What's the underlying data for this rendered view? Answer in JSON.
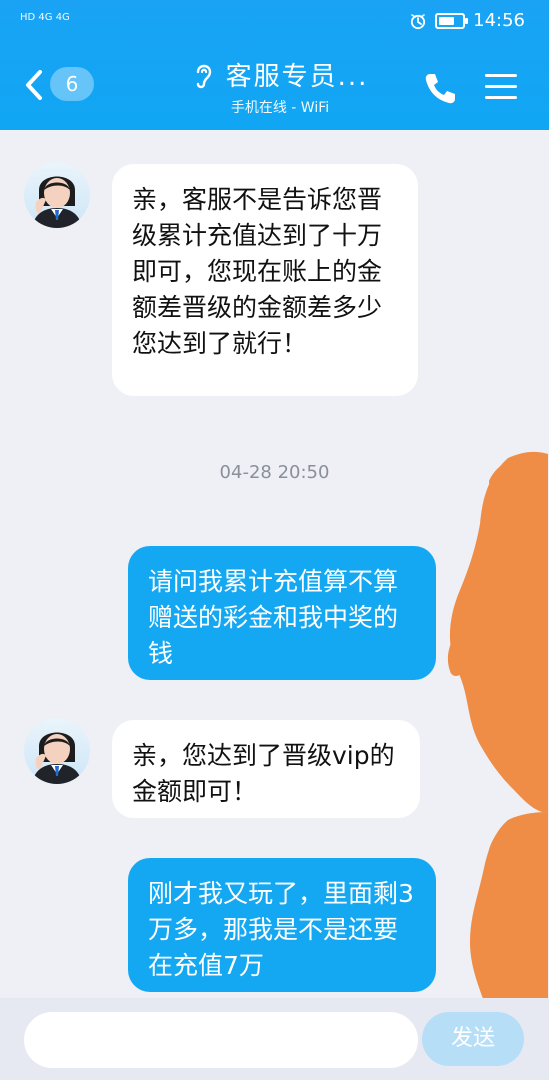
{
  "status_bar": {
    "left": "HD 4G 4G",
    "time": "14:56",
    "battery_level": 0.68
  },
  "header": {
    "back_count": "6",
    "title": "客服专员...",
    "subtitle": "手机在线 - WiFi"
  },
  "messages": [
    {
      "side": "left",
      "text": "亲，客服不是告诉您晋级累计充值达到了十万即可，您现在账上的金额差晋级的金额差多少您达到了就行！"
    },
    {
      "side": "timestamp",
      "text": "04-28 20:50"
    },
    {
      "side": "right",
      "text": "请问我累计充值算不算赠送的彩金和我中奖的钱"
    },
    {
      "side": "left",
      "text": "亲，您达到了晋级vip的金额即可！"
    },
    {
      "side": "right",
      "text": "刚才我又玩了，里面剩3万多，那我是不是还要在充值7万"
    }
  ],
  "composer": {
    "placeholder": "",
    "send_label": "发送"
  },
  "colors": {
    "header": "#12a4f4",
    "outgoing_bubble": "#15a8f2",
    "incoming_bubble": "#ffffff",
    "background": "#eef0f6",
    "scribble": "#ef8c45"
  },
  "icons": {
    "back": "chevron-left-icon",
    "ear": "ear-icon",
    "phone": "phone-icon",
    "menu": "menu-icon"
  }
}
